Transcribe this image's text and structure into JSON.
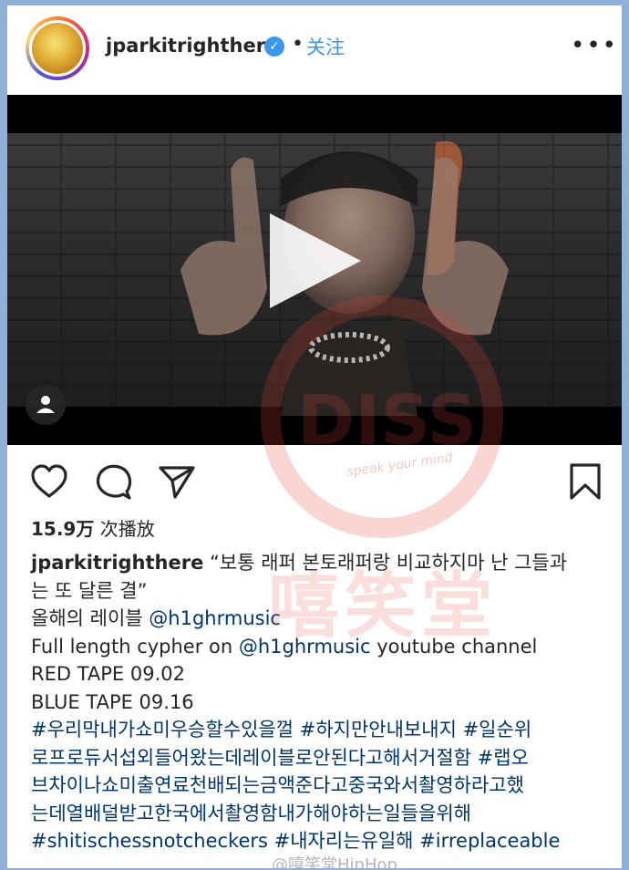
{
  "post": {
    "username": "jparkitrighthere",
    "follow_label": "关注",
    "dot": "•",
    "more_icon": "more-options-icon"
  },
  "video": {
    "play_icon": "play-icon",
    "tagged_icon": "person-tag-icon"
  },
  "actions": {
    "like_icon": "heart-icon",
    "comment_icon": "comment-icon",
    "share_icon": "send-icon",
    "save_icon": "bookmark-icon"
  },
  "stats": {
    "views_count": "15.9万",
    "views_label": "次播放"
  },
  "caption": {
    "username": "jparkitrighthere",
    "line1_text": "“보통 래퍼 본토래퍼랑 비교하지마 난 그들과",
    "line2_text": "는 또 달른 결”",
    "line3_text": "올해의 레이블 ",
    "line3_mention": "@h1ghrmusic",
    "line4_pre": "Full length cypher on ",
    "line4_mention": "@h1ghrmusic",
    "line4_post": " youtube channel",
    "line5": "RED TAPE 09.02",
    "line6": "BLUE TAPE 09.16",
    "hashtag_line1": "#우리막내가쇼미우승할수있을껄 #하지만안내보내지 #일순위",
    "hashtag_line2": "로프로듀서섭외들어왔는데레이블로안된다고해서거절함 #랩오",
    "hashtag_line3": "브차이나쇼미출연료천배되는금액준다고중국와서촬영하라고했",
    "hashtag_line4": "는데열배덜받고한국에서촬영함내가해야하는일들을위해",
    "hashtag_line5": "#shitischessnotcheckers #내자리는유일해 #irreplaceable"
  },
  "watermarks": {
    "diss": "DISS",
    "slogan": "speak your mind",
    "cn": "嘻笑堂",
    "weibo": "@嘻笑堂HipHop"
  },
  "colors": {
    "link": "#003569",
    "follow": "#3897f0",
    "border": "#8fb0d6"
  }
}
